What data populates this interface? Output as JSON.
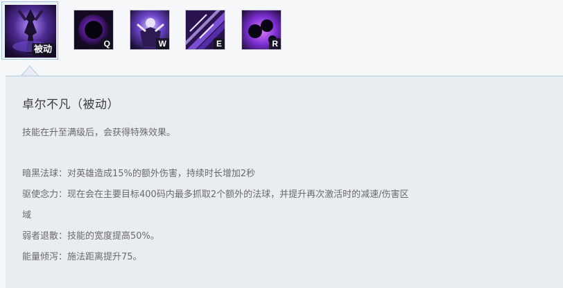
{
  "skills": [
    {
      "id": "passive",
      "key_label": "被动",
      "selected": true
    },
    {
      "id": "q",
      "key_label": "Q",
      "selected": false
    },
    {
      "id": "w",
      "key_label": "W",
      "selected": false
    },
    {
      "id": "e",
      "key_label": "E",
      "selected": false
    },
    {
      "id": "r",
      "key_label": "R",
      "selected": false
    }
  ],
  "detail": {
    "title": "卓尔不凡（被动）",
    "summary": "技能在升至满级后，会获得特殊效果。",
    "effects": [
      {
        "text": "暗黑法球：对英雄造成15%的额外伤害，持续时长增加2秒"
      },
      {
        "text": "驱使念力：现在会在主要目标400码内最多抓取2个额外的法球，并提升再次激活时的减速/伤害区"
      },
      {
        "text": "域"
      },
      {
        "text": "弱者退散：技能的宽度提高50%。"
      },
      {
        "text": "能量倾泻：施法距离提升75。"
      }
    ]
  },
  "colors": {
    "panel_bg": "#e9ecf1",
    "accent_border": "#a9cde8",
    "skill_purple": "#7b3fd6"
  }
}
